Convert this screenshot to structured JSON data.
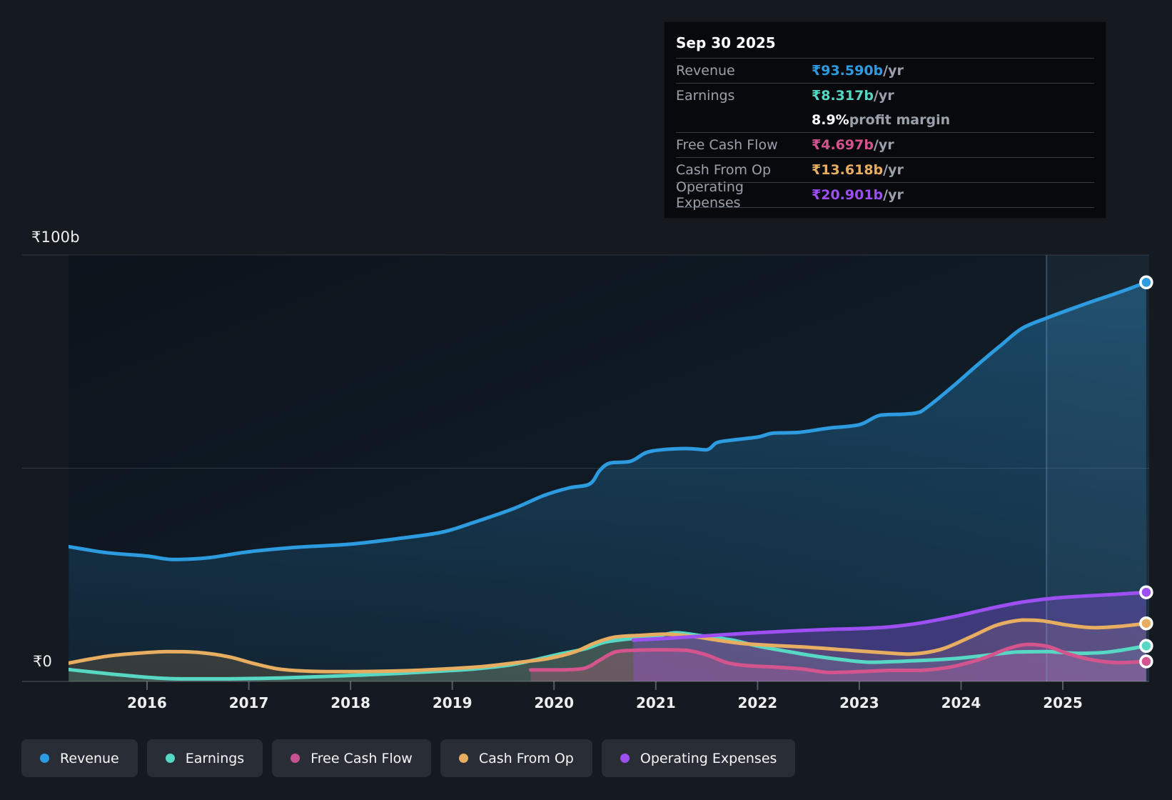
{
  "tooltip": {
    "date": "Sep 30 2025",
    "rows": [
      {
        "label": "Revenue",
        "value": "₹93.590b",
        "suffix": " /yr",
        "color": "#2c9bdf"
      },
      {
        "label": "Earnings",
        "value": "₹8.317b",
        "suffix": " /yr",
        "color": "#57d8c5",
        "extra": {
          "value": "8.9%",
          "text": " profit margin"
        }
      },
      {
        "label": "Free Cash Flow",
        "value": "₹4.697b",
        "suffix": " /yr",
        "color": "#d4548e"
      },
      {
        "label": "Cash From Op",
        "value": "₹13.618b",
        "suffix": " /yr",
        "color": "#e7ad60"
      },
      {
        "label": "Operating Expenses",
        "value": "₹20.901b",
        "suffix": " /yr",
        "color": "#9d4ff2"
      }
    ]
  },
  "axes": {
    "y_top": "₹100b",
    "y_zero": "₹0",
    "years": [
      "2016",
      "2017",
      "2018",
      "2019",
      "2020",
      "2021",
      "2022",
      "2023",
      "2024",
      "2025"
    ]
  },
  "legend": [
    {
      "label": "Revenue",
      "color": "#2c9bdf"
    },
    {
      "label": "Earnings",
      "color": "#57d8c5"
    },
    {
      "label": "Free Cash Flow",
      "color": "#c4538f"
    },
    {
      "label": "Cash From Op",
      "color": "#e7ad60"
    },
    {
      "label": "Operating Expenses",
      "color": "#9d4ff2"
    }
  ],
  "chart_data": {
    "type": "area",
    "unit": "INR billions",
    "ylim": [
      0,
      100
    ],
    "gridline_values": [
      0,
      50,
      100
    ],
    "x_years_shown": [
      2016,
      2017,
      2018,
      2019,
      2020,
      2021,
      2022,
      2023,
      2024,
      2025
    ],
    "x_range": [
      2015.23,
      2025.82
    ],
    "highlight_band_start": 2024.84,
    "legend_position": "bottom",
    "series": [
      {
        "name": "Revenue",
        "color": "#2c9bdf",
        "fill": [
          "rgba(44,155,223,0.36)",
          "rgba(44,155,223,0.07)"
        ],
        "points": [
          [
            2015.23,
            31.6
          ],
          [
            2015.6,
            30.2
          ],
          [
            2016,
            29.4
          ],
          [
            2016.25,
            28.6
          ],
          [
            2016.6,
            29.0
          ],
          [
            2017,
            30.4
          ],
          [
            2017.5,
            31.5
          ],
          [
            2018,
            32.2
          ],
          [
            2018.5,
            33.6
          ],
          [
            2018.9,
            35.0
          ],
          [
            2019.2,
            37.2
          ],
          [
            2019.6,
            40.5
          ],
          [
            2019.9,
            43.6
          ],
          [
            2020.15,
            45.4
          ],
          [
            2020.35,
            46.3
          ],
          [
            2020.45,
            49.5
          ],
          [
            2020.55,
            51.2
          ],
          [
            2020.75,
            51.6
          ],
          [
            2020.9,
            53.6
          ],
          [
            2021.05,
            54.3
          ],
          [
            2021.3,
            54.6
          ],
          [
            2021.5,
            54.3
          ],
          [
            2021.6,
            56.0
          ],
          [
            2021.75,
            56.6
          ],
          [
            2022,
            57.3
          ],
          [
            2022.15,
            58.2
          ],
          [
            2022.4,
            58.4
          ],
          [
            2022.7,
            59.4
          ],
          [
            2023,
            60.2
          ],
          [
            2023.2,
            62.4
          ],
          [
            2023.45,
            62.7
          ],
          [
            2023.6,
            63.2
          ],
          [
            2023.9,
            68.8
          ],
          [
            2024.15,
            74.0
          ],
          [
            2024.4,
            79.0
          ],
          [
            2024.6,
            82.8
          ],
          [
            2024.85,
            85.3
          ],
          [
            2025.1,
            87.5
          ],
          [
            2025.3,
            89.2
          ],
          [
            2025.55,
            91.2
          ],
          [
            2025.82,
            93.59
          ]
        ]
      },
      {
        "name": "Earnings",
        "color": "#57d8c5",
        "fill": [
          "rgba(87,216,197,0.15)",
          "rgba(87,216,197,0.15)"
        ],
        "points": [
          [
            2015.23,
            2.8
          ],
          [
            2015.7,
            1.6
          ],
          [
            2016.1,
            0.8
          ],
          [
            2016.35,
            0.6
          ],
          [
            2016.8,
            0.6
          ],
          [
            2017.3,
            0.8
          ],
          [
            2017.8,
            1.2
          ],
          [
            2018.3,
            1.7
          ],
          [
            2018.8,
            2.3
          ],
          [
            2019.2,
            2.9
          ],
          [
            2019.55,
            3.8
          ],
          [
            2019.8,
            5.0
          ],
          [
            2020.05,
            6.4
          ],
          [
            2020.3,
            7.6
          ],
          [
            2020.5,
            9.2
          ],
          [
            2020.75,
            10.0
          ],
          [
            2021,
            10.6
          ],
          [
            2021.2,
            11.4
          ],
          [
            2021.45,
            10.7
          ],
          [
            2021.75,
            9.7
          ],
          [
            2022,
            8.3
          ],
          [
            2022.3,
            7.0
          ],
          [
            2022.55,
            6.0
          ],
          [
            2022.8,
            5.2
          ],
          [
            2023.1,
            4.5
          ],
          [
            2023.5,
            4.8
          ],
          [
            2023.9,
            5.3
          ],
          [
            2024.2,
            6.0
          ],
          [
            2024.55,
            6.9
          ],
          [
            2024.85,
            7.0
          ],
          [
            2025.15,
            6.6
          ],
          [
            2025.45,
            6.9
          ],
          [
            2025.82,
            8.317
          ]
        ]
      },
      {
        "name": "Free Cash Flow",
        "color": "#d4548e",
        "fill": [
          "rgba(212,84,142,0.27)",
          "rgba(212,84,142,0.27)"
        ],
        "points": [
          [
            2019.77,
            2.7
          ],
          [
            2020.05,
            2.7
          ],
          [
            2020.3,
            3.1
          ],
          [
            2020.45,
            5.0
          ],
          [
            2020.6,
            6.9
          ],
          [
            2020.8,
            7.3
          ],
          [
            2021.05,
            7.4
          ],
          [
            2021.3,
            7.3
          ],
          [
            2021.5,
            6.2
          ],
          [
            2021.7,
            4.4
          ],
          [
            2021.9,
            3.7
          ],
          [
            2022.15,
            3.4
          ],
          [
            2022.45,
            2.9
          ],
          [
            2022.7,
            2.1
          ],
          [
            2023,
            2.3
          ],
          [
            2023.3,
            2.6
          ],
          [
            2023.6,
            2.6
          ],
          [
            2023.9,
            3.4
          ],
          [
            2024.2,
            5.3
          ],
          [
            2024.45,
            7.6
          ],
          [
            2024.65,
            8.7
          ],
          [
            2024.85,
            8.2
          ],
          [
            2025.05,
            6.5
          ],
          [
            2025.3,
            5.0
          ],
          [
            2025.55,
            4.4
          ],
          [
            2025.82,
            4.697
          ]
        ]
      },
      {
        "name": "Cash From Op",
        "color": "#e7ad60",
        "fill": [
          "rgba(231,173,96,0.17)",
          "rgba(231,173,96,0.17)"
        ],
        "points": [
          [
            2015.23,
            4.3
          ],
          [
            2015.6,
            5.9
          ],
          [
            2015.9,
            6.6
          ],
          [
            2016.2,
            7.0
          ],
          [
            2016.5,
            6.8
          ],
          [
            2016.8,
            5.8
          ],
          [
            2017.05,
            4.2
          ],
          [
            2017.3,
            2.9
          ],
          [
            2017.6,
            2.4
          ],
          [
            2018,
            2.3
          ],
          [
            2018.5,
            2.5
          ],
          [
            2018.9,
            2.9
          ],
          [
            2019.3,
            3.5
          ],
          [
            2019.7,
            4.6
          ],
          [
            2019.95,
            5.4
          ],
          [
            2020.2,
            6.9
          ],
          [
            2020.4,
            9.0
          ],
          [
            2020.6,
            10.4
          ],
          [
            2020.85,
            10.8
          ],
          [
            2021.1,
            11.1
          ],
          [
            2021.35,
            10.6
          ],
          [
            2021.6,
            9.7
          ],
          [
            2021.85,
            8.9
          ],
          [
            2022.1,
            8.5
          ],
          [
            2022.5,
            8.0
          ],
          [
            2022.85,
            7.4
          ],
          [
            2023.2,
            6.8
          ],
          [
            2023.5,
            6.4
          ],
          [
            2023.8,
            7.5
          ],
          [
            2024.1,
            10.5
          ],
          [
            2024.35,
            13.2
          ],
          [
            2024.6,
            14.4
          ],
          [
            2024.8,
            14.2
          ],
          [
            2025.05,
            13.2
          ],
          [
            2025.3,
            12.6
          ],
          [
            2025.55,
            12.9
          ],
          [
            2025.82,
            13.618
          ]
        ]
      },
      {
        "name": "Operating Expenses",
        "color": "#9d4ff2",
        "fill": [
          "rgba(157,79,242,0.30)",
          "rgba(157,79,242,0.30)"
        ],
        "points": [
          [
            2020.78,
            9.7
          ],
          [
            2021.1,
            10.1
          ],
          [
            2021.5,
            10.7
          ],
          [
            2021.9,
            11.3
          ],
          [
            2022.3,
            11.8
          ],
          [
            2022.7,
            12.2
          ],
          [
            2023,
            12.4
          ],
          [
            2023.3,
            12.8
          ],
          [
            2023.6,
            13.7
          ],
          [
            2023.95,
            15.3
          ],
          [
            2024.3,
            17.2
          ],
          [
            2024.6,
            18.6
          ],
          [
            2024.9,
            19.5
          ],
          [
            2025.2,
            20.0
          ],
          [
            2025.5,
            20.4
          ],
          [
            2025.82,
            20.901
          ]
        ]
      }
    ]
  }
}
